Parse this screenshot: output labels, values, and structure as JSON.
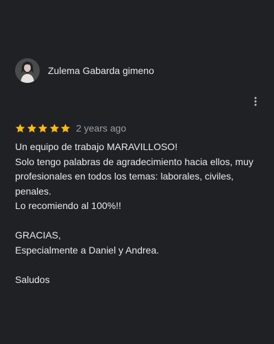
{
  "reviewer": {
    "name": "Zulema Gabarda gimeno",
    "avatar_icon": "person-photo"
  },
  "menu": {
    "icon": "more-vertical-icon"
  },
  "rating": {
    "stars": 5,
    "max_stars": 5,
    "star_color": "#fbbc04",
    "time_ago": "2 years ago"
  },
  "review": {
    "lines": [
      "Un equipo de trabajo MARAVILLOSO!",
      "Solo tengo palabras de agradecimiento hacia ellos, muy profesionales en todos los temas: laborales, civiles, penales.",
      "Lo recomiendo al 100%!!",
      "",
      "GRACIAS,",
      "Especialmente a Daniel y Andrea.",
      "",
      "Saludos"
    ]
  },
  "colors": {
    "background": "#202124",
    "text": "#e8eaed",
    "secondary_text": "#9aa0a6"
  }
}
